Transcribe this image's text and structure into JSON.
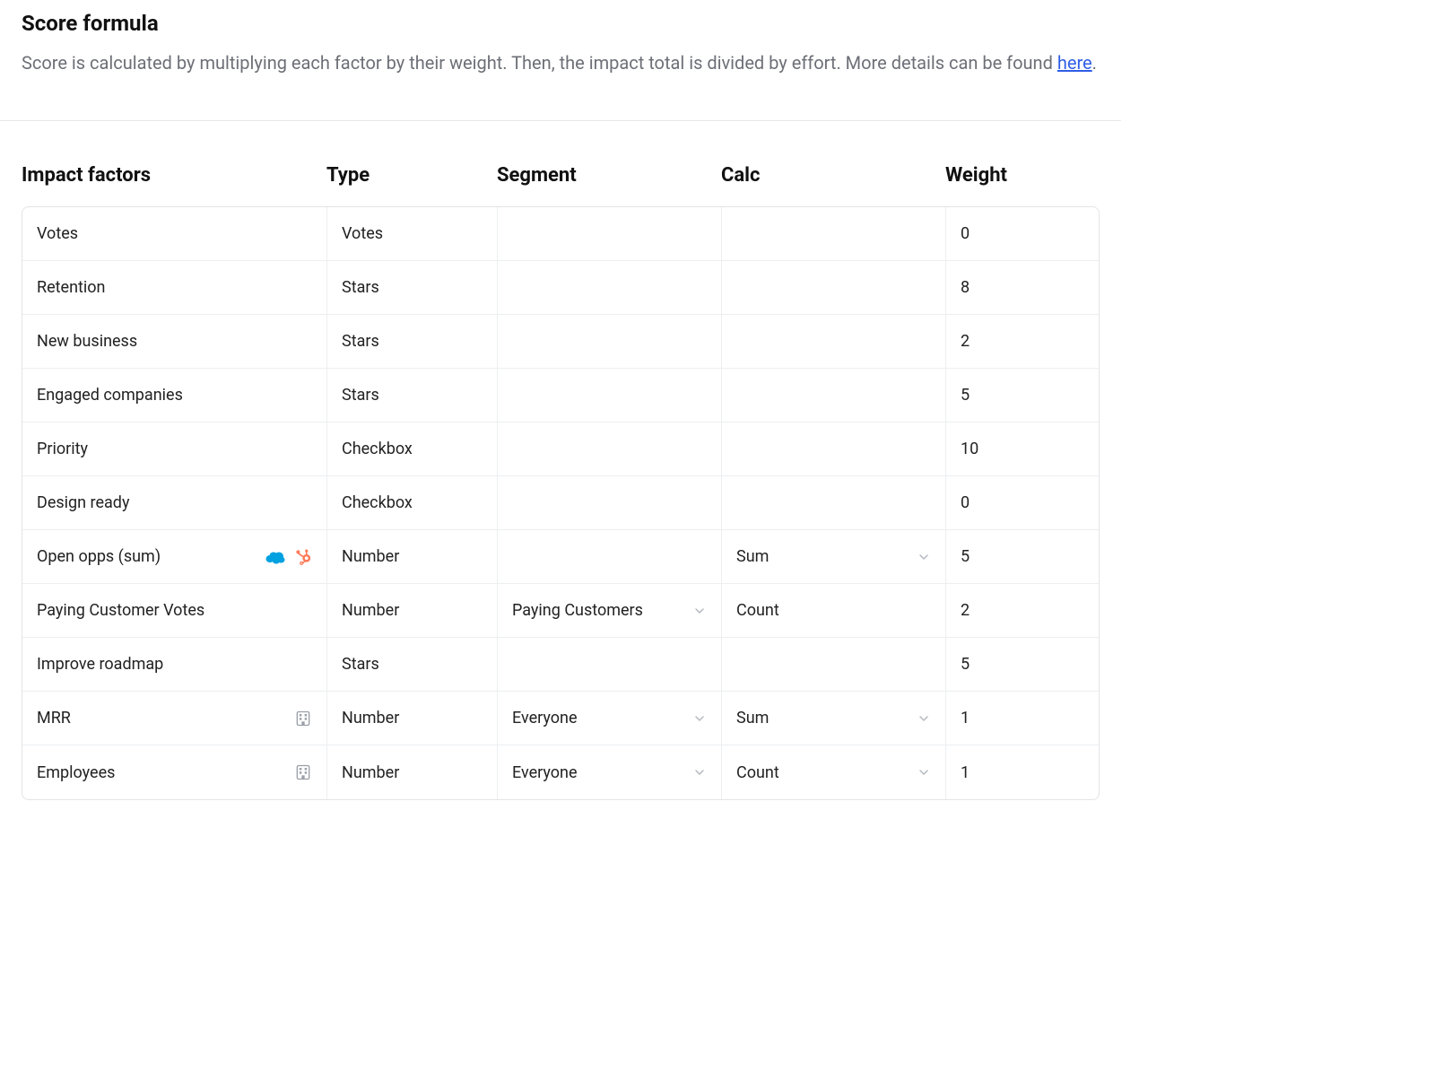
{
  "header": {
    "title": "Score formula",
    "description_prefix": "Score is calculated by multiplying each factor by their weight. Then, the impact total is divided by effort. More details can be found ",
    "link_text": "here",
    "period": "."
  },
  "columns": {
    "c0": "Impact factors",
    "c1": "Type",
    "c2": "Segment",
    "c3": "Calc",
    "c4": "Weight"
  },
  "rows": [
    {
      "name": "Votes",
      "type": "Votes",
      "segment": "",
      "calc": "",
      "weight": "0",
      "icons": [],
      "segment_dd": false,
      "calc_dd": false
    },
    {
      "name": "Retention",
      "type": "Stars",
      "segment": "",
      "calc": "",
      "weight": "8",
      "icons": [],
      "segment_dd": false,
      "calc_dd": false
    },
    {
      "name": "New business",
      "type": "Stars",
      "segment": "",
      "calc": "",
      "weight": "2",
      "icons": [],
      "segment_dd": false,
      "calc_dd": false
    },
    {
      "name": "Engaged companies",
      "type": "Stars",
      "segment": "",
      "calc": "",
      "weight": "5",
      "icons": [],
      "segment_dd": false,
      "calc_dd": false
    },
    {
      "name": "Priority",
      "type": "Checkbox",
      "segment": "",
      "calc": "",
      "weight": "10",
      "icons": [],
      "segment_dd": false,
      "calc_dd": false
    },
    {
      "name": "Design ready",
      "type": "Checkbox",
      "segment": "",
      "calc": "",
      "weight": "0",
      "icons": [],
      "segment_dd": false,
      "calc_dd": false
    },
    {
      "name": "Open opps (sum)",
      "type": "Number",
      "segment": "",
      "calc": "Sum",
      "weight": "5",
      "icons": [
        "salesforce",
        "hubspot"
      ],
      "segment_dd": false,
      "calc_dd": true
    },
    {
      "name": "Paying Customer Votes",
      "type": "Number",
      "segment": "Paying Customers",
      "calc": "Count",
      "weight": "2",
      "icons": [],
      "segment_dd": true,
      "calc_dd": false
    },
    {
      "name": "Improve roadmap",
      "type": "Stars",
      "segment": "",
      "calc": "",
      "weight": "5",
      "icons": [],
      "segment_dd": false,
      "calc_dd": false
    },
    {
      "name": "MRR",
      "type": "Number",
      "segment": "Everyone",
      "calc": "Sum",
      "weight": "1",
      "icons": [
        "building"
      ],
      "segment_dd": true,
      "calc_dd": true
    },
    {
      "name": "Employees",
      "type": "Number",
      "segment": "Everyone",
      "calc": "Count",
      "weight": "1",
      "icons": [
        "building"
      ],
      "segment_dd": true,
      "calc_dd": true
    }
  ]
}
